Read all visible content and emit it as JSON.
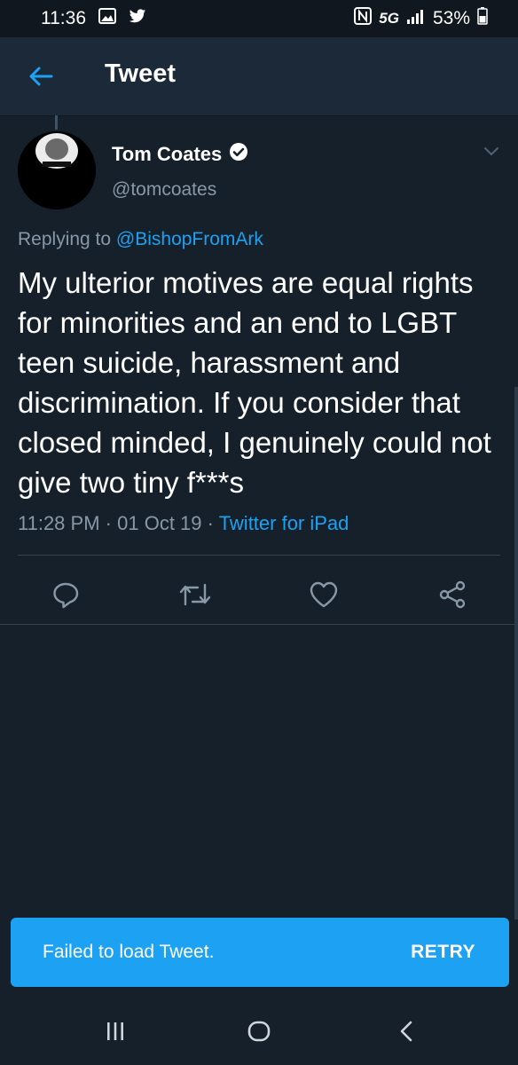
{
  "status_bar": {
    "time": "11:36",
    "network": "5G",
    "battery": "53%"
  },
  "header": {
    "title": "Tweet"
  },
  "tweet": {
    "author_name": "Tom Coates",
    "author_handle": "@tomcoates",
    "verified": true,
    "replying_prefix": "Replying to",
    "replying_to": "@BishopFromArk",
    "text": "My ulterior motives are equal rights for minorities and an end to LGBT teen suicide, harassment and discrimination. If you consider that closed minded, I genuinely could not give two tiny f***s",
    "time": "11:28 PM",
    "date": "01 Oct 19",
    "source": "Twitter for iPad"
  },
  "actions": {
    "icons": [
      "reply-icon",
      "retweet-icon",
      "like-icon",
      "share-icon"
    ]
  },
  "snackbar": {
    "message": "Failed to load Tweet.",
    "action": "RETRY"
  },
  "colors": {
    "background": "#15202b",
    "header": "#1c2938",
    "accent": "#1da1f2",
    "muted": "#8899a6",
    "divider": "#38444d"
  }
}
